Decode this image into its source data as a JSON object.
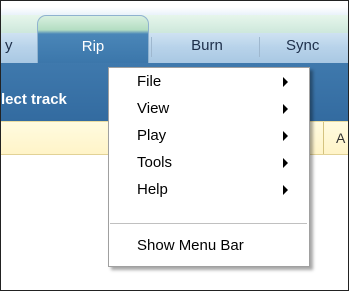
{
  "tabs": {
    "play_partial": "y",
    "rip": "Rip",
    "burn": "Burn",
    "sync_partial": "Sync"
  },
  "content": {
    "bar_title_partial": "lect track",
    "column_partial": "A"
  },
  "menu": {
    "items": [
      {
        "label": "File",
        "submenu": true,
        "icon": "submenu-arrow-icon"
      },
      {
        "label": "View",
        "submenu": true,
        "icon": "submenu-arrow-icon"
      },
      {
        "label": "Play",
        "submenu": true,
        "icon": "submenu-arrow-icon"
      },
      {
        "label": "Tools",
        "submenu": true,
        "icon": "submenu-arrow-icon"
      },
      {
        "label": "Help",
        "submenu": true,
        "icon": "submenu-arrow-icon"
      }
    ],
    "show_menu_bar": "Show Menu Bar"
  }
}
